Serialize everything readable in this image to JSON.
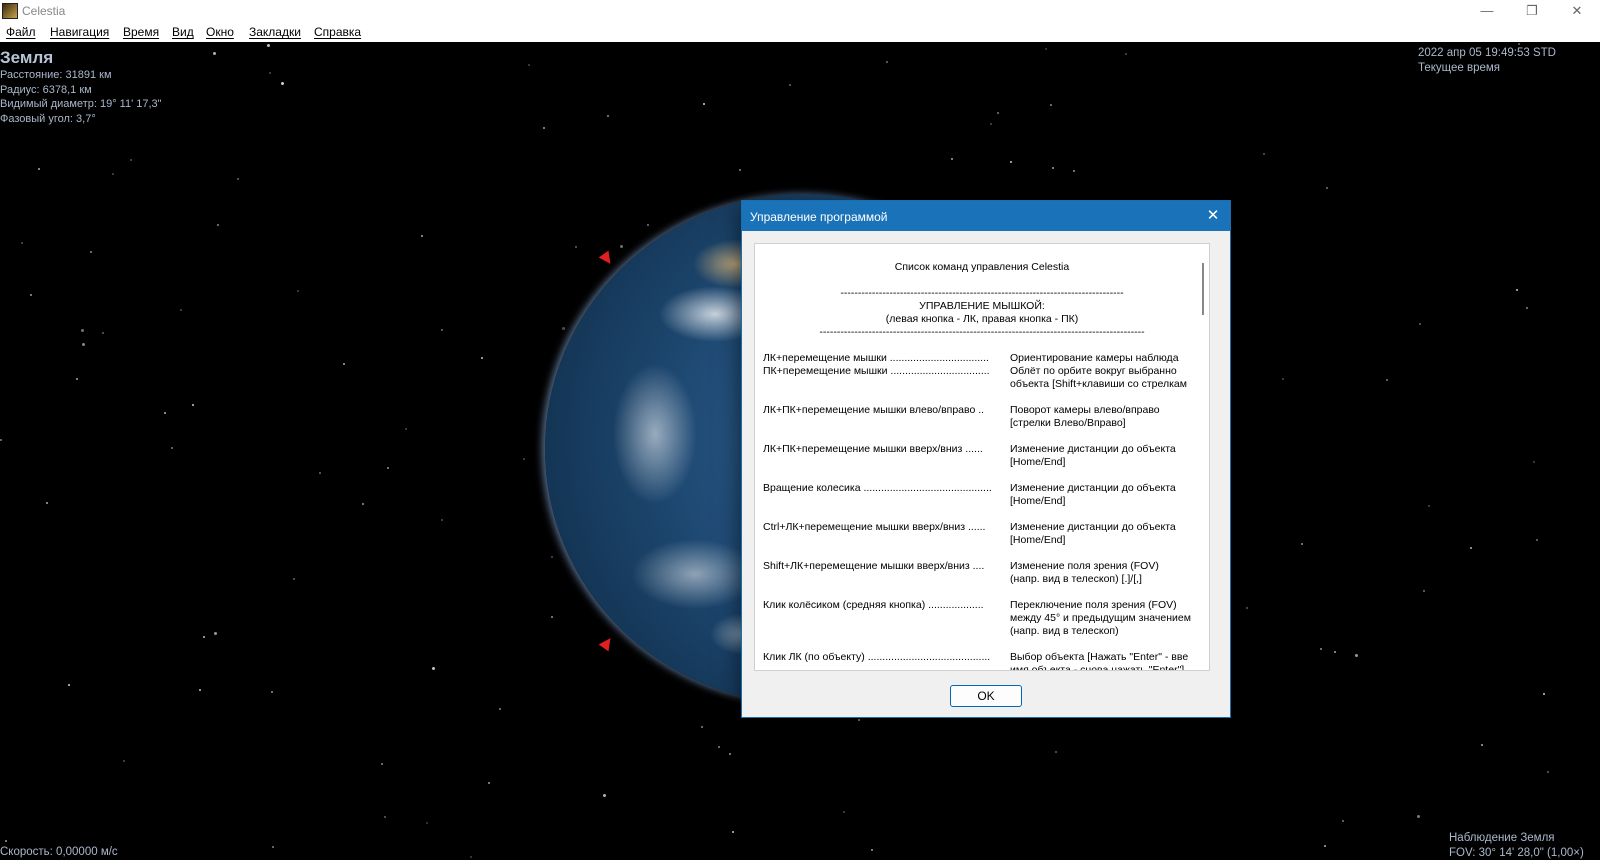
{
  "window": {
    "title": "Celestia",
    "minimize_label": "—",
    "restore_label": "❐",
    "close_label": "✕"
  },
  "menu": [
    "Файл",
    "Навигация",
    "Время",
    "Вид",
    "Окно",
    "Закладки",
    "Справка"
  ],
  "object_info": {
    "name": "Земля",
    "distance": "Расстояние: 31891 км",
    "radius": "Радиус: 6378,1 км",
    "apparent_diameter": "Видимый диаметр: 19° 11' 17,3\"",
    "phase_angle": "Фазовый угол: 3,7°"
  },
  "time_info": {
    "datetime": "2022 апр 05 19:49:53 STD",
    "mode": "Текущее время"
  },
  "view_info": {
    "tracking": "Наблюдение Земля",
    "fov": "FOV: 30° 14' 28,0\" (1,00×)"
  },
  "speed": "Скорость: 0,00000 м/с",
  "dialog": {
    "title": "Управление программой",
    "close_label": "✕",
    "ok_label": "OK",
    "heading": "Список команд управления Celestia",
    "separator_1": "---------------------------------------------------------------------------------",
    "section_title": "УПРАВЛЕНИЕ МЫШКОЙ:",
    "section_subtitle": "(левая кнопка - ЛК, правая кнопка - ПК)",
    "separator_2": "---------------------------------------------------------------------------------------------",
    "commands": [
      {
        "left": "ЛК+перемещение мышки ..................................",
        "right": "Ориентирование камеры наблюда"
      },
      {
        "left": "ПК+перемещение мышки ..................................",
        "right": "Облёт по орбите вокруг выбранно"
      },
      {
        "left": "",
        "right": "объекта [Shift+клавиши со стрелкам"
      },
      {
        "left": "",
        "right": ""
      },
      {
        "left": "ЛК+ПК+перемещение мышки влево/вправо ..",
        "right": "Поворот камеры влево/вправо"
      },
      {
        "left": "",
        "right": "[стрелки Влево/Вправо]"
      },
      {
        "left": "",
        "right": ""
      },
      {
        "left": "ЛК+ПК+перемещение мышки вверх/вниз ......",
        "right": "Изменение дистанции до объекта"
      },
      {
        "left": "",
        "right": "[Home/End]"
      },
      {
        "left": "",
        "right": ""
      },
      {
        "left": "Вращение колесика ............................................",
        "right": "Изменение дистанции до объекта"
      },
      {
        "left": "",
        "right": "[Home/End]"
      },
      {
        "left": "",
        "right": ""
      },
      {
        "left": "Ctrl+ЛК+перемещение мышки вверх/вниз ......",
        "right": "Изменение дистанции до объекта"
      },
      {
        "left": "",
        "right": "[Home/End]"
      },
      {
        "left": "",
        "right": ""
      },
      {
        "left": "Shift+ЛК+перемещение мышки вверх/вниз ....",
        "right": "Изменение поля зрения (FOV)"
      },
      {
        "left": "",
        "right": "(напр. вид в телескоп) [.]/[,]"
      },
      {
        "left": "",
        "right": ""
      },
      {
        "left": "Клик колёсиком (средняя кнопка) ...................",
        "right": "Переключение поля зрения (FOV)"
      },
      {
        "left": "",
        "right": "между 45° и предыдущим значением"
      },
      {
        "left": "",
        "right": "(напр. вид в телескоп)"
      },
      {
        "left": "",
        "right": ""
      },
      {
        "left": "Клик ЛК (по объекту) ..........................................",
        "right": "Выбор объекта [Нажать \"Enter\" - вве"
      },
      {
        "left": "",
        "right": "имя объекта - снова нажать \"Enter\"]"
      }
    ]
  }
}
